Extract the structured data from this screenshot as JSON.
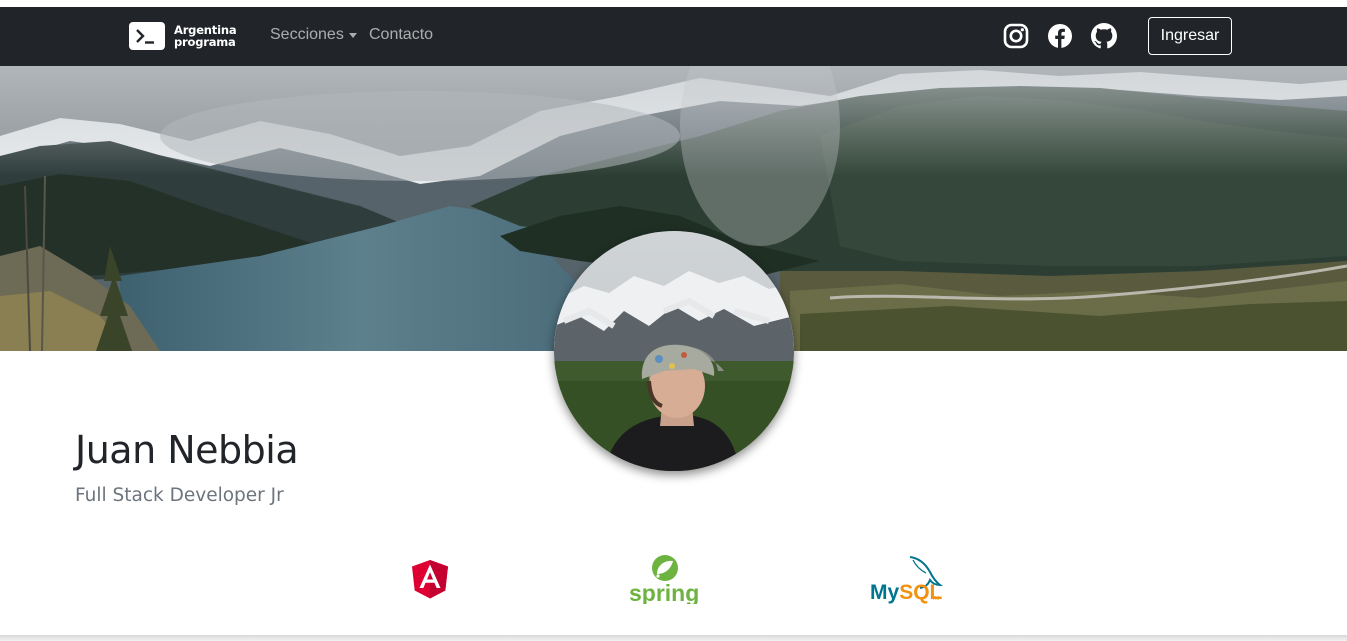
{
  "navbar": {
    "brand": {
      "line1": "Argentina",
      "line2": "programa",
      "icon": "terminal-icon"
    },
    "links": [
      {
        "label": "Secciones",
        "has_dropdown": true
      },
      {
        "label": "Contacto",
        "has_dropdown": false
      }
    ],
    "social_icons": [
      "instagram-icon",
      "facebook-icon",
      "github-icon"
    ],
    "login_label": "Ingresar",
    "background": "#212529"
  },
  "profile": {
    "name": "Juan Nebbia",
    "title": "Full Stack Developer Jr"
  },
  "technologies": [
    {
      "name": "angular-logo",
      "color": "#dd0031"
    },
    {
      "name": "spring-logo",
      "label": "spring",
      "color": "#6db33f"
    },
    {
      "name": "mysql-logo",
      "label_main": "MySQL",
      "label_tm": "TM",
      "color": "#00758f",
      "accent": "#f29111"
    }
  ]
}
